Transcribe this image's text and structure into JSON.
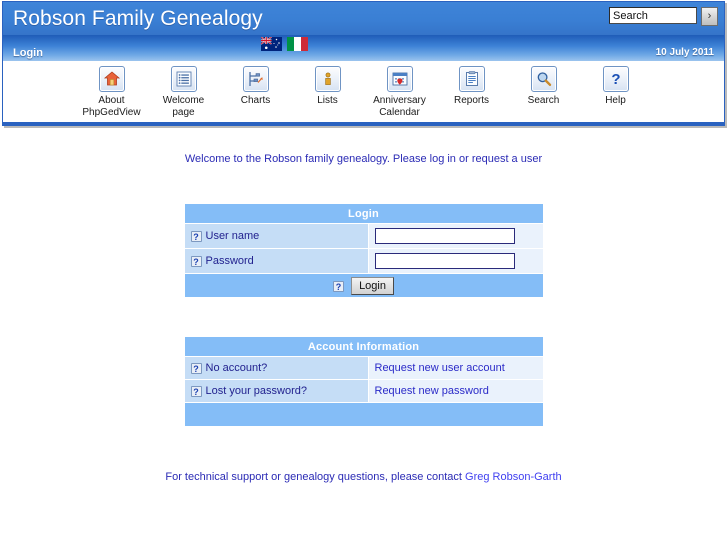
{
  "header": {
    "site_title": "Robson Family Genealogy",
    "search": {
      "value": "Search",
      "placeholder": "Search",
      "go_label": "›"
    },
    "sub_bar": {
      "left_label": "Login",
      "date": "10 July 2011"
    },
    "flags": [
      {
        "name": "australia-flag",
        "title": "Australia"
      },
      {
        "name": "italy-flag",
        "title": "Italy"
      }
    ]
  },
  "toolbar": [
    {
      "icon": "home-icon",
      "line1": "About",
      "line2": "PhpGedView"
    },
    {
      "icon": "list-lines-icon",
      "line1": "Welcome",
      "line2": "page"
    },
    {
      "icon": "chart-icon",
      "line1": "Charts",
      "line2": ""
    },
    {
      "icon": "person-icon",
      "line1": "Lists",
      "line2": ""
    },
    {
      "icon": "calendar-heart-icon",
      "line1": "Anniversary",
      "line2": "Calendar"
    },
    {
      "icon": "report-icon",
      "line1": "Reports",
      "line2": ""
    },
    {
      "icon": "magnifier-icon",
      "line1": "Search",
      "line2": ""
    },
    {
      "icon": "question-icon",
      "line1": "Help",
      "line2": ""
    }
  ],
  "main": {
    "welcome_text": "Welcome to the Robson family genealogy. Please log in or request a user",
    "login_table": {
      "title": "Login",
      "username_label": "User name",
      "username_value": "",
      "password_label": "Password",
      "password_value": "",
      "submit_label": "Login",
      "help_glyph": "?"
    },
    "account_table": {
      "title": "Account Information",
      "rows": [
        {
          "label": "No account?",
          "link": "Request new user account"
        },
        {
          "label": "Lost your password?",
          "link": "Request new password"
        }
      ]
    }
  },
  "footer": {
    "text": "For technical support or genealogy questions, please contact ",
    "contact": "Greg Robson-Garth"
  },
  "colors": {
    "title_bar": "#3a7fd4",
    "sub_bar_top": "#1f5cb8",
    "table_header": "#84bdf7",
    "label_cell": "#c5ddf6",
    "value_cell": "#eaf2fc",
    "link": "#2b2bc8",
    "text_blue": "#2b2bb5",
    "border_blue": "#2a62c0"
  }
}
